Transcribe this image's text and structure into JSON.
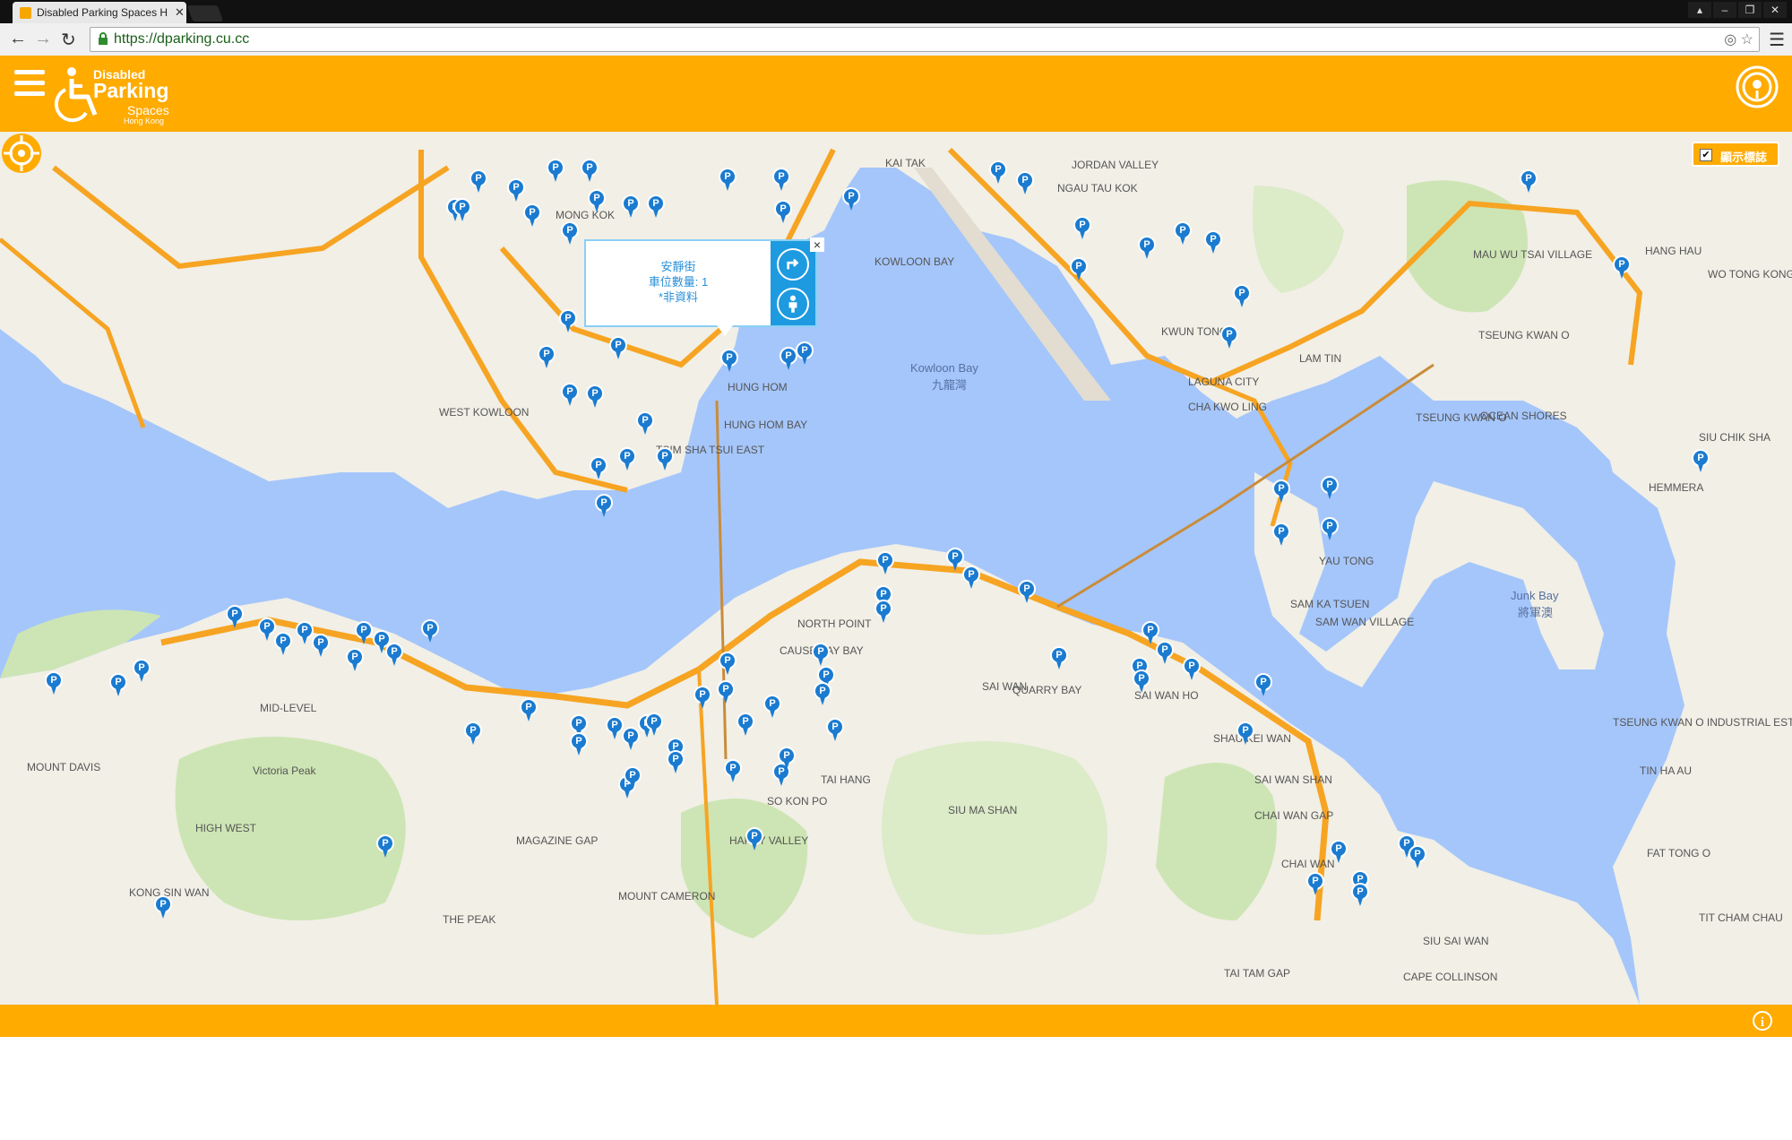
{
  "browser": {
    "tab_title": "Disabled Parking Spaces H",
    "url": "https://dparking.cu.cc"
  },
  "header": {
    "logo_line1": "Disabled",
    "logo_line2": "Parking",
    "logo_line3": "Spaces",
    "logo_line4": "Hong Kong"
  },
  "map": {
    "legend_toggle_label": "顯示標誌",
    "popup": {
      "name": "安靜街",
      "count": "車位數量: 1",
      "note": "*非資料"
    },
    "place_labels": [
      "KAI TAK",
      "JORDAN VALLEY",
      "NGAU TAU KOK",
      "KOWLOON BAY",
      "Kowloon Bay",
      "九龍灣",
      "KWUN TONG",
      "LAGUNA CITY",
      "CHA KWO LING",
      "LAM TIN",
      "OCEAN SHORES",
      "TSEUNG KWAN O",
      "MAU WU TSAI VILLAGE",
      "HANG HAU",
      "WO TONG KONG",
      "SIU CHIK SHA",
      "HEMMERA",
      "WEST KOWLOON",
      "HUNG HOM",
      "MONG KOK",
      "TSIM SHA TSUI EAST",
      "HUNG HOM BAY",
      "NORTH POINT",
      "CAUSEWAY BAY",
      "QUARRY BAY",
      "SAI WAN HO",
      "SHAU KEI WAN",
      "YAU TONG",
      "SAM KA TSUEN",
      "SAI WAN SHAN",
      "CHAI WAN GAP",
      "CHAI WAN",
      "Junk Bay",
      "將軍澳",
      "MID-LEVEL",
      "MOUNT DAVIS",
      "Victoria Peak",
      "HIGH WEST",
      "MAGAZINE GAP",
      "MOUNT CAMERON",
      "THE PEAK",
      "KONG SIN WAN",
      "HAPPY VALLEY",
      "SO KON PO",
      "TAI HANG",
      "SIU MA SHAN",
      "TAI TAM GAP",
      "CAPE COLLINSON",
      "SIU SAI WAN",
      "TSEUNG KWAN O INDUSTRIAL ESTATE",
      "TIN HA AU",
      "FAT TONG O",
      "TIT CHAM CHAU",
      "SAI WAN",
      "SAM WAN VILLAGE",
      "TSEUNG KWAN O"
    ],
    "pin_glyph": "P",
    "colors": {
      "water": "#a5c6fb",
      "land": "#f1efe6",
      "park": "#cde5b4",
      "highway": "#f6a422",
      "pin": "#1a7bd0",
      "brand": "#ffab00"
    }
  },
  "footer": {
    "info_glyph": "i"
  }
}
